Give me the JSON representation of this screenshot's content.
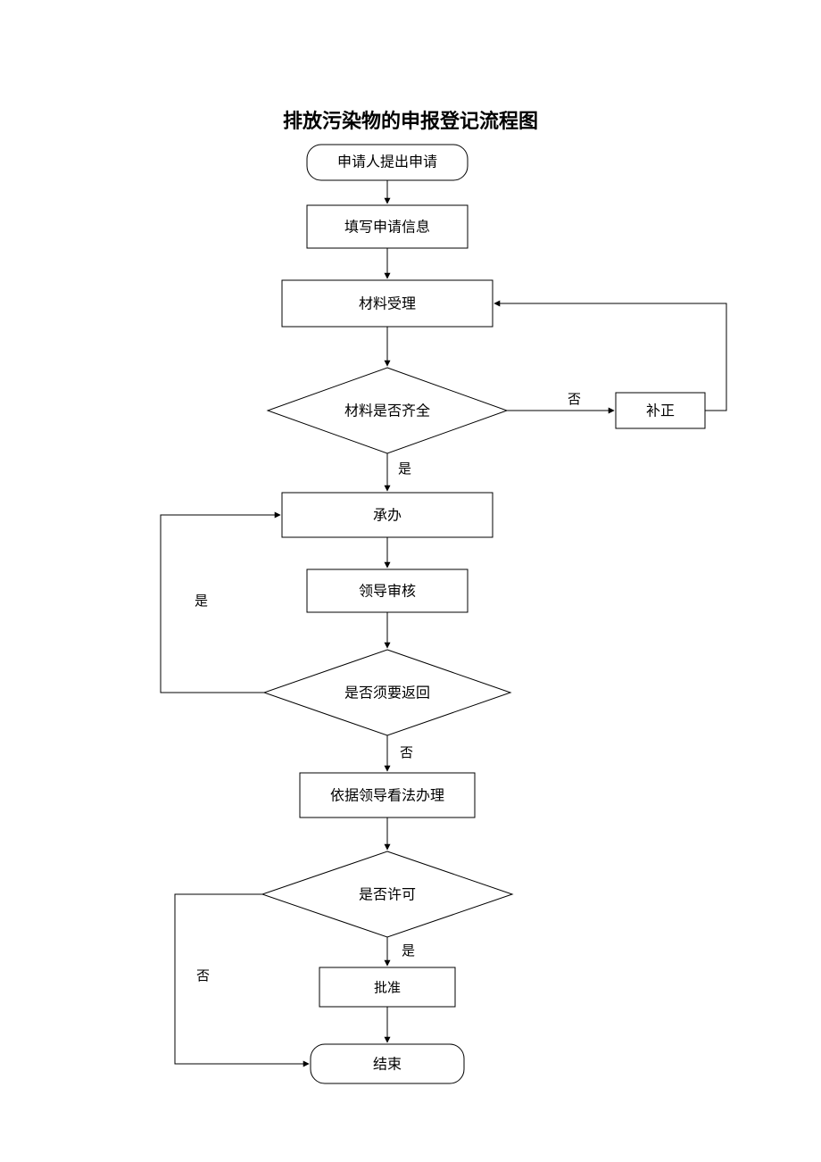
{
  "title": "排放污染物的申报登记流程图",
  "nodes": {
    "start": "申请人提出申请",
    "fill_info": "填写申请信息",
    "accept": "材料受理",
    "complete_q": "材料是否齐全",
    "correction": "补正",
    "handle": "承办",
    "review": "领导审核",
    "return_q": "是否须要返回",
    "process": "依据领导看法办理",
    "permit_q": "是否许可",
    "approve": "批准",
    "end": "结束"
  },
  "edge_labels": {
    "yes": "是",
    "no": "否",
    "no2": "否"
  }
}
